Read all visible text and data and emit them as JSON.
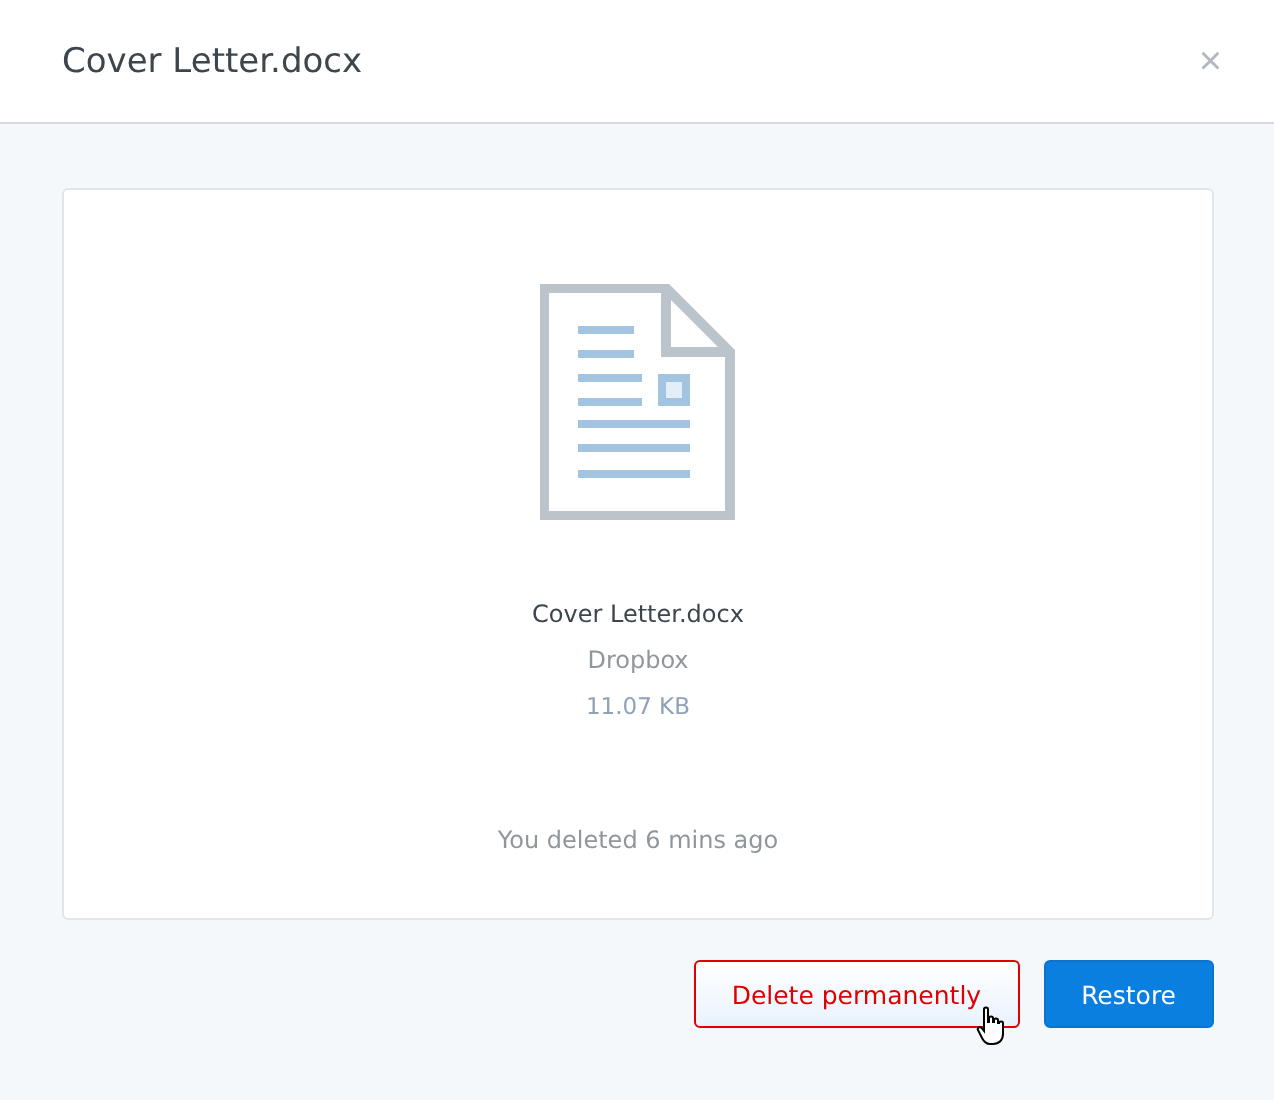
{
  "window": {
    "title": "Cover Letter.docx",
    "close": "×"
  },
  "file": {
    "name": "Cover Letter.docx",
    "location": "Dropbox",
    "size": "11.07 KB",
    "status": "You deleted 6 mins ago"
  },
  "buttons": [
    {
      "label": "Delete permanently",
      "kind": "danger",
      "hovered": true
    },
    {
      "label": "Restore",
      "kind": "primary",
      "hovered": false
    }
  ]
}
